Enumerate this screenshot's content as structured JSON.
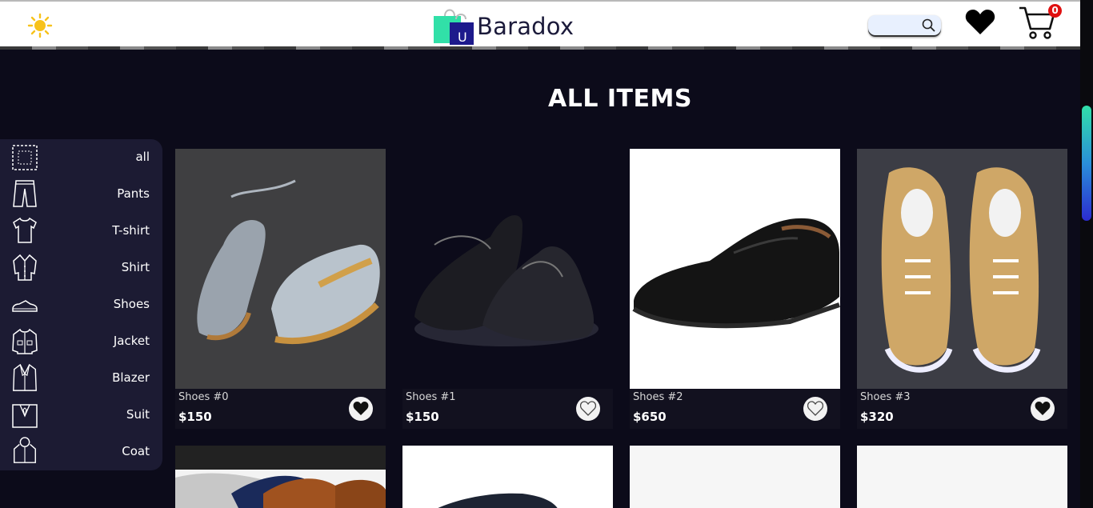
{
  "header": {
    "brand": "Baradox",
    "logo_letter": "U",
    "search": {
      "value": "",
      "placeholder": ""
    },
    "cart_count": "0",
    "icons": [
      "sun-icon",
      "heart-icon",
      "cart-icon",
      "search-icon"
    ]
  },
  "page": {
    "title": "ALL ITEMS"
  },
  "sidebar": {
    "items": [
      {
        "label": "all",
        "icon": "all-icon"
      },
      {
        "label": "Pants",
        "icon": "pants-icon"
      },
      {
        "label": "T-shirt",
        "icon": "tshirt-icon"
      },
      {
        "label": "Shirt",
        "icon": "shirt-icon"
      },
      {
        "label": "Shoes",
        "icon": "shoe-icon"
      },
      {
        "label": "Jacket",
        "icon": "jacket-icon"
      },
      {
        "label": "Blazer",
        "icon": "blazer-icon"
      },
      {
        "label": "Suit",
        "icon": "suit-icon"
      },
      {
        "label": "Coat",
        "icon": "coat-icon"
      }
    ]
  },
  "products": [
    {
      "name": "Shoes #0",
      "price": "$150",
      "favorited": true,
      "bg": "#3f3f41"
    },
    {
      "name": "Shoes #1",
      "price": "$150",
      "favorited": false,
      "bg": "#0c0b1a"
    },
    {
      "name": "Shoes #2",
      "price": "$650",
      "favorited": false,
      "bg": "#ffffff"
    },
    {
      "name": "Shoes #3",
      "price": "$320",
      "favorited": true,
      "bg": "#3c3d45"
    }
  ],
  "colors": {
    "background": "#0c0b1a",
    "sidebar": "#1c1b33",
    "accent_green": "#31e0a8",
    "accent_blue": "#2b2bd0",
    "badge": "#e01010"
  }
}
